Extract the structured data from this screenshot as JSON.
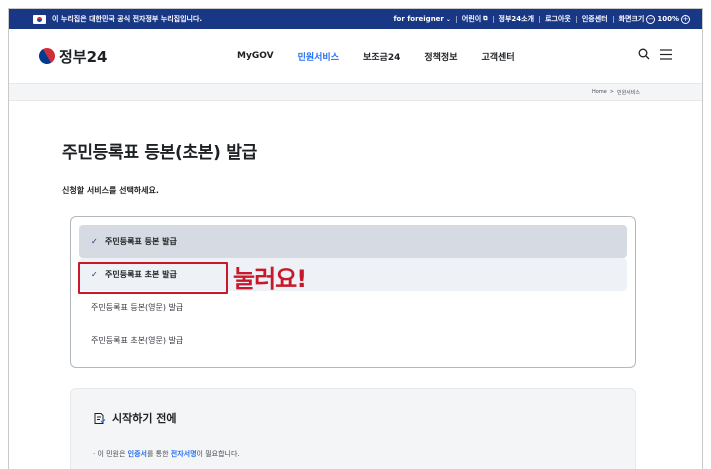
{
  "topbar": {
    "notice": "이 누리집은 대한민국 공식 전자정부 누리집입니다.",
    "foreigner": "for foreigner",
    "kids": "어린이",
    "intro": "정부24소개",
    "logout": "로그아웃",
    "cert": "인증센터",
    "zoom_label": "화면크기",
    "zoom_value": "100%"
  },
  "header": {
    "logo_text": "정부24",
    "nav": [
      {
        "label": "MyGOV"
      },
      {
        "label": "민원서비스",
        "active": true
      },
      {
        "label": "보조금24"
      },
      {
        "label": "정책정보"
      },
      {
        "label": "고객센터"
      }
    ]
  },
  "breadcrumb": {
    "home": "Home",
    "sep": ">",
    "current": "민원서비스"
  },
  "main": {
    "title": "주민등록표 등본(초본) 발급",
    "subhead": "신청할 서비스를 선택하세요.",
    "options": [
      {
        "label": "주민등록표 등본 발급",
        "state": "selected"
      },
      {
        "label": "주민등록표 초본 발급",
        "state": "hover"
      },
      {
        "label": "주민등록표 등본(영문) 발급",
        "state": "normal"
      },
      {
        "label": "주민등록표 초본(영문) 발급",
        "state": "normal"
      }
    ],
    "annotation": "눌러요!"
  },
  "before_start": {
    "title": "시작하기 전에",
    "line_prefix": "· 이 민원은 ",
    "line_hl1": "인증서",
    "line_mid": "를 통한 ",
    "line_hl2": "전자서명",
    "line_suffix": "이 필요합니다."
  },
  "colors": {
    "topbar_bg": "#183886",
    "accent": "#256ef4",
    "annotation": "#c8192b"
  }
}
